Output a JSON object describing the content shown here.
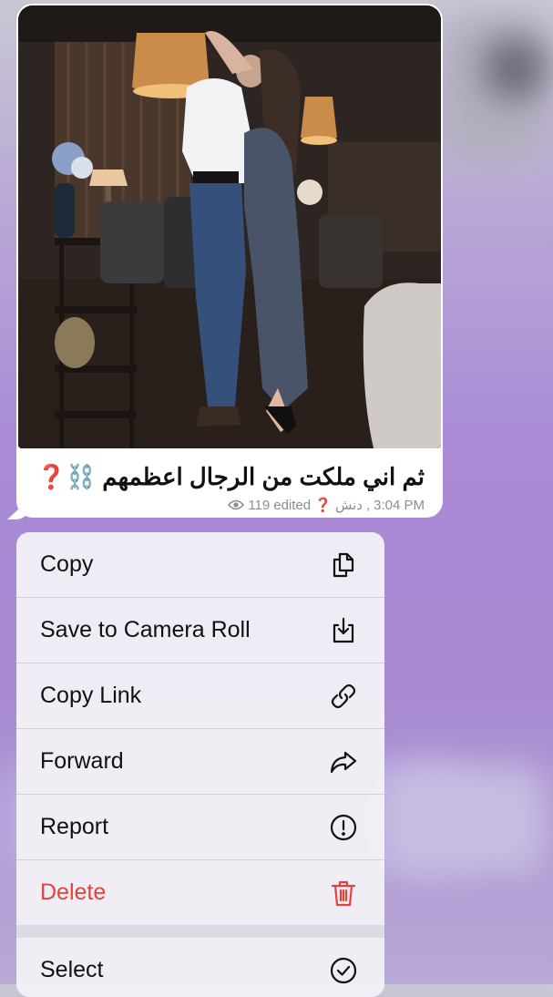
{
  "message": {
    "caption": "ثم اني ملكت من الرجال اعظمهم ⛓️❓",
    "views": "119",
    "edited_label": "edited",
    "author": "دنش ❓",
    "time": "3:04 PM",
    "photo_alt_icon": "photo-of-couple"
  },
  "menu": {
    "items": [
      {
        "label": "Copy",
        "icon": "copy-icon"
      },
      {
        "label": "Save to Camera Roll",
        "icon": "save-icon"
      },
      {
        "label": "Copy Link",
        "icon": "link-icon"
      },
      {
        "label": "Forward",
        "icon": "forward-icon"
      },
      {
        "label": "Report",
        "icon": "report-icon"
      },
      {
        "label": "Delete",
        "icon": "trash-icon"
      },
      {
        "label": "Select",
        "icon": "check-circle-icon"
      }
    ]
  },
  "colors": {
    "danger": "#e5423d",
    "meta_text": "#8d8d94"
  }
}
